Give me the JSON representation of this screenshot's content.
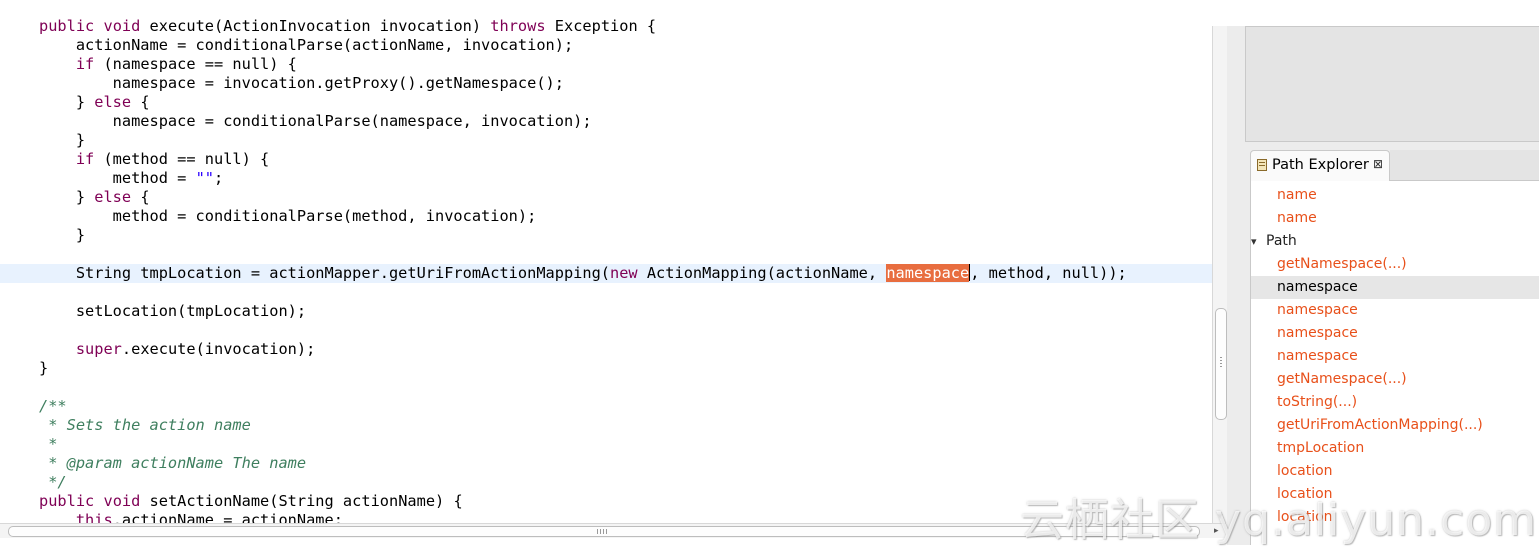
{
  "editor": {
    "lines": [
      [
        {
          "t": "public",
          "c": "kw"
        },
        {
          "t": " "
        },
        {
          "t": "void",
          "c": "kw"
        },
        {
          "t": " execute(ActionInvocation invocation) "
        },
        {
          "t": "throws",
          "c": "kw"
        },
        {
          "t": " Exception {"
        }
      ],
      [
        {
          "t": "    actionName = conditionalParse(actionName, invocation);"
        }
      ],
      [
        {
          "t": "    "
        },
        {
          "t": "if",
          "c": "kw"
        },
        {
          "t": " (namespace == null) {"
        }
      ],
      [
        {
          "t": "        namespace = invocation.getProxy().getNamespace();"
        }
      ],
      [
        {
          "t": "    } "
        },
        {
          "t": "else",
          "c": "kw"
        },
        {
          "t": " {"
        }
      ],
      [
        {
          "t": "        namespace = conditionalParse(namespace, invocation);"
        }
      ],
      [
        {
          "t": "    }"
        }
      ],
      [
        {
          "t": "    "
        },
        {
          "t": "if",
          "c": "kw"
        },
        {
          "t": " (method == null) {"
        }
      ],
      [
        {
          "t": "        method = "
        },
        {
          "t": "\"\"",
          "c": "str"
        },
        {
          "t": ";"
        }
      ],
      [
        {
          "t": "    } "
        },
        {
          "t": "else",
          "c": "kw"
        },
        {
          "t": " {"
        }
      ],
      [
        {
          "t": "        method = conditionalParse(method, invocation);"
        }
      ],
      [
        {
          "t": "    }"
        }
      ],
      [
        {
          "t": ""
        }
      ],
      [
        {
          "t": "    String tmpLocation = actionMapper.getUriFromActionMapping("
        },
        {
          "t": "new",
          "c": "kw"
        },
        {
          "t": " ActionMapping(actionName, "
        },
        {
          "t": "namespace",
          "c": "hl"
        },
        {
          "t": "",
          "c": "caret"
        },
        {
          "t": ", method, null));"
        }
      ],
      [
        {
          "t": ""
        }
      ],
      [
        {
          "t": "    setLocation(tmpLocation);"
        }
      ],
      [
        {
          "t": ""
        }
      ],
      [
        {
          "t": "    "
        },
        {
          "t": "super",
          "c": "kw"
        },
        {
          "t": ".execute(invocation);"
        }
      ],
      [
        {
          "t": "}"
        }
      ],
      [
        {
          "t": ""
        }
      ],
      [
        {
          "t": "/**",
          "c": "cm"
        }
      ],
      [
        {
          "t": " * Sets the action name",
          "c": "cm"
        }
      ],
      [
        {
          "t": " *",
          "c": "cm"
        }
      ],
      [
        {
          "t": " * @param actionName The name",
          "c": "cm"
        }
      ],
      [
        {
          "t": " */",
          "c": "cm"
        }
      ],
      [
        {
          "t": "public",
          "c": "kw"
        },
        {
          "t": " "
        },
        {
          "t": "void",
          "c": "kw"
        },
        {
          "t": " setActionName(String actionName) {"
        }
      ],
      [
        {
          "t": "    "
        },
        {
          "t": "this",
          "c": "kw"
        },
        {
          "t": ".actionName = actionName;"
        }
      ]
    ],
    "current_line": 13
  },
  "path_explorer": {
    "title": "Path Explorer",
    "close_glyph": "⊠",
    "items": [
      {
        "label": "name",
        "kind": "node"
      },
      {
        "label": "name",
        "kind": "node"
      },
      {
        "label": "Path",
        "kind": "path",
        "expanded_glyph": "▾"
      },
      {
        "label": "getNamespace(...)",
        "kind": "node"
      },
      {
        "label": "namespace",
        "kind": "node",
        "selected": true
      },
      {
        "label": "namespace",
        "kind": "node"
      },
      {
        "label": "namespace",
        "kind": "node"
      },
      {
        "label": "namespace",
        "kind": "node"
      },
      {
        "label": "getNamespace(...)",
        "kind": "node"
      },
      {
        "label": "toString(...)",
        "kind": "node"
      },
      {
        "label": "getUriFromActionMapping(...)",
        "kind": "node"
      },
      {
        "label": "tmpLocation",
        "kind": "node"
      },
      {
        "label": "location",
        "kind": "node"
      },
      {
        "label": "location",
        "kind": "node"
      },
      {
        "label": "location",
        "kind": "node"
      }
    ]
  },
  "scrollbars": {
    "down_glyph": "▾",
    "right_glyph": "▸"
  },
  "watermark": {
    "text": "云栖社区 yq.aliyun.com"
  }
}
